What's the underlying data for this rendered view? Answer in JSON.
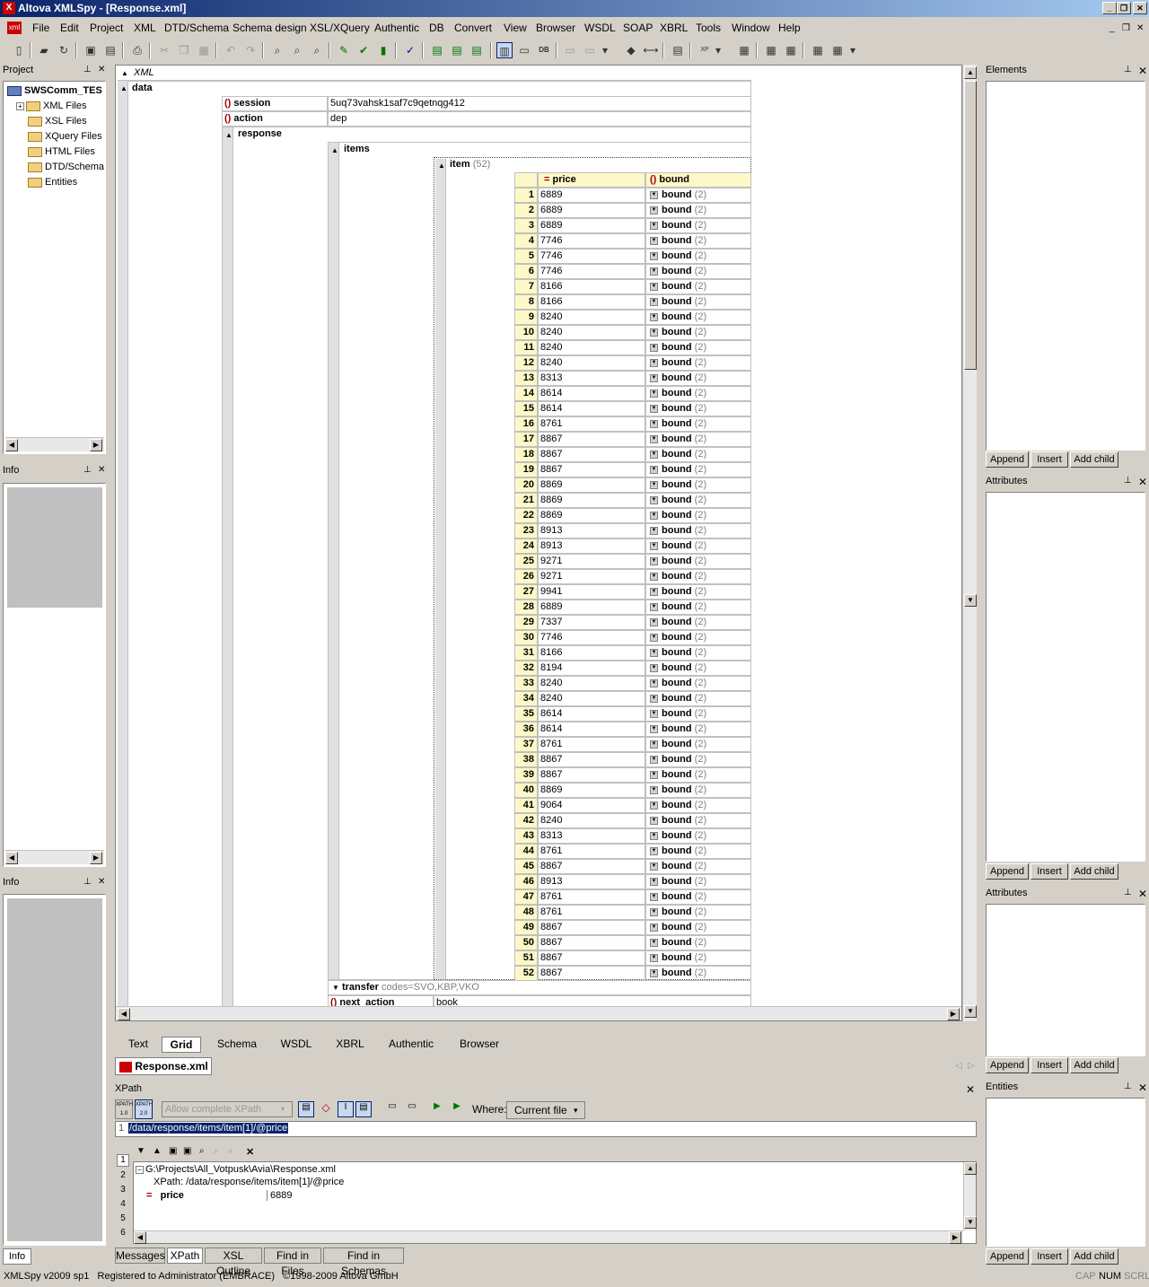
{
  "window": {
    "title": "Altova XMLSpy - [Response.xml]",
    "app_icon": "xmlspy-icon",
    "btn_minimize": "_",
    "btn_restore": "❐",
    "btn_close": "✕"
  },
  "menu": [
    "File",
    "Edit",
    "Project",
    "XML",
    "DTD/Schema",
    "Schema design",
    "XSL/XQuery",
    "Authentic",
    "DB",
    "Convert",
    "View",
    "Browser",
    "WSDL",
    "SOAP",
    "XBRL",
    "Tools",
    "Window",
    "Help"
  ],
  "mdi": {
    "minimize": "_",
    "restore": "❐",
    "close": "✕"
  },
  "project": {
    "title": "Project",
    "pin": "⊥",
    "close": "✕",
    "root": "SWSComm_TES",
    "items": [
      "XML Files",
      "XSL Files",
      "XQuery Files",
      "HTML Files",
      "DTD/Schema",
      "Entities"
    ]
  },
  "info1": {
    "title": "Info",
    "pin": "⊥",
    "close": "✕"
  },
  "info2": {
    "title": "Info",
    "pin": "⊥",
    "close": "✕"
  },
  "info_tab": "Info",
  "elements": {
    "title": "Elements",
    "pin": "⊥",
    "close": "✕"
  },
  "attributes1": {
    "title": "Attributes",
    "pin": "⊥",
    "close": "✕"
  },
  "attributes2": {
    "title": "Attributes",
    "pin": "⊥",
    "close": "✕"
  },
  "entities": {
    "title": "Entities",
    "pin": "⊥",
    "close": "✕"
  },
  "side_buttons": {
    "append": "Append",
    "insert": "Insert",
    "add_child": "Add child"
  },
  "grid": {
    "xml_label": "XML",
    "data_label": "data",
    "session_label": "session",
    "session_value": "5uq73vahsk1saf7c9qetnqg412",
    "action_label": "action",
    "action_value": "dep",
    "response_label": "response",
    "items_label": "items",
    "item_label": "item",
    "item_count": "(52)",
    "col_price": "price",
    "col_bound": "bound",
    "bound_text": "bound",
    "bound_count": "(2)",
    "transfer_label": "transfer",
    "transfer_value": "codes=SVO,KBP,VKO",
    "next_action_label": "next_action",
    "next_action_value": "book",
    "elem_icon": "()",
    "attr_icon": "="
  },
  "prices": [
    "6889",
    "6889",
    "6889",
    "7746",
    "7746",
    "7746",
    "8166",
    "8166",
    "8240",
    "8240",
    "8240",
    "8240",
    "8313",
    "8614",
    "8614",
    "8761",
    "8867",
    "8867",
    "8867",
    "8869",
    "8869",
    "8869",
    "8913",
    "8913",
    "9271",
    "9271",
    "9941",
    "6889",
    "7337",
    "7746",
    "8166",
    "8194",
    "8240",
    "8240",
    "8614",
    "8614",
    "8761",
    "8867",
    "8867",
    "8869",
    "9064",
    "8240",
    "8313",
    "8761",
    "8867",
    "8913",
    "8761",
    "8761",
    "8867",
    "8867",
    "8867",
    "8867"
  ],
  "view_tabs": [
    "Text",
    "Grid",
    "Schema",
    "WSDL",
    "XBRL",
    "Authentic",
    "Browser"
  ],
  "doc_tab": "Response.xml",
  "xpath": {
    "title": "XPath",
    "close": "✕",
    "btn_xpath10": "XPATH 1.0",
    "btn_xpath20": "XPATH 2.0",
    "allow_placeholder": "Allow complete XPath",
    "where_label": "Where:",
    "where_value": "Current file",
    "line_no": "1",
    "expression": "/data/response/items/item[1]/@price",
    "result_path": "G:\\Projects\\All_Votpusk\\Avia\\Response.xml",
    "result_xpath": "XPath: /data/response/items/item[1]/@price",
    "result_name": "price",
    "result_value": "6889",
    "side_tabs": [
      "1",
      "2",
      "3",
      "4",
      "5",
      "6"
    ]
  },
  "bottom_tabs": [
    "Messages",
    "XPath",
    "XSL Outline",
    "Find in Files",
    "Find in Schemas"
  ],
  "status": {
    "left": "XMLSpy v2009 sp1   Registered to Administrator (EMBRACE)   ©1998-2009 Altova GmbH",
    "cap": "CAP",
    "num": "NUM",
    "scrl": "SCRL"
  }
}
